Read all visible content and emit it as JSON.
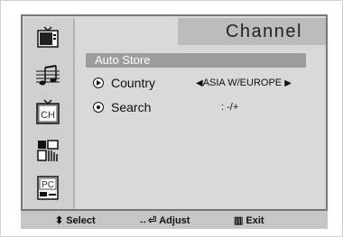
{
  "menu": {
    "title": "Channel",
    "tabs": [
      {
        "name": "picture",
        "label": ""
      },
      {
        "name": "sound",
        "label": ""
      },
      {
        "name": "channel",
        "label": "CH",
        "selected": true
      },
      {
        "name": "setup",
        "label": ""
      },
      {
        "name": "pc",
        "label": "PC"
      }
    ],
    "items": [
      {
        "label": "Auto Store",
        "highlighted": true
      },
      {
        "label": "Country",
        "value": "ASIA W/EUROPE"
      },
      {
        "label": "Search",
        "value": ": -/+"
      }
    ]
  },
  "footer": {
    "select_icon": "◆",
    "select_label": "Select",
    "adjust_label": "Adjust",
    "exit_label": "Exit"
  },
  "colors": {
    "panel": "#d9d9d9",
    "highlight": "#9c9c9c",
    "title_bg": "#bcbcbc",
    "footer_bg": "#c6c6c6"
  }
}
